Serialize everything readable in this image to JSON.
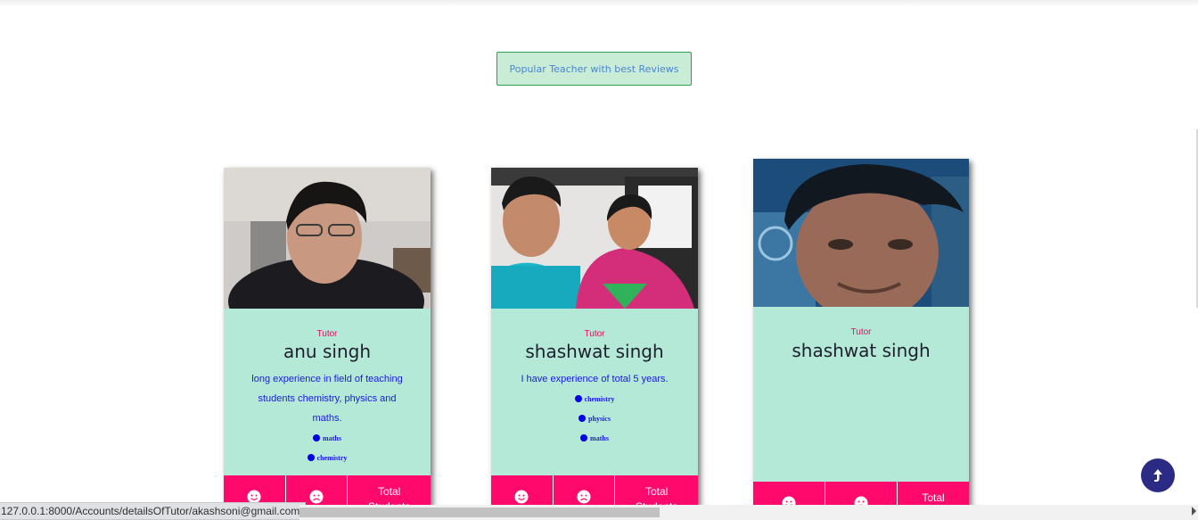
{
  "section": {
    "button_label": "Popular Teacher with best Reviews"
  },
  "cards": [
    {
      "role": "Tutor",
      "name": "anu singh",
      "bio": "long experience in field of teaching students chemistry, physics and maths.",
      "subjects": [
        "maths",
        "chemistry"
      ],
      "footer": {
        "like_icon": "smile-icon",
        "dislike_icon": "sad-face-icon",
        "total_label": "Total Students"
      }
    },
    {
      "role": "Tutor",
      "name": "shashwat singh",
      "bio": "I have experience of total 5 years.",
      "subjects": [
        "chemistry",
        "physics",
        "maths"
      ],
      "footer": {
        "like_icon": "smile-icon",
        "dislike_icon": "sad-face-icon",
        "total_label": "Total Students"
      }
    },
    {
      "role": "Tutor",
      "name": "shashwat singh",
      "bio": "",
      "subjects": [],
      "footer": {
        "like_icon": "smile-icon",
        "dislike_icon": "sad-face-icon",
        "total_label": "Total"
      }
    }
  ],
  "scroll_top_button": {
    "icon": "arrow-up-icon"
  },
  "status_bar": {
    "url": "127.0.0.1:8000/Accounts/detailsOfTutor/akashsoni@gmail.com"
  },
  "colors": {
    "card_bg": "#b3e9d6",
    "accent": "#ff0a6c",
    "name_text": "#1f1f2e",
    "link_blue": "#1a1adb",
    "fab": "#2b2b86"
  }
}
